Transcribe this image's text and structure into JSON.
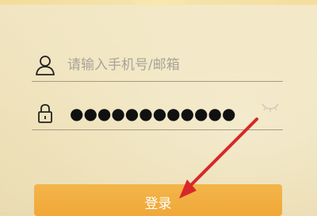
{
  "login_form": {
    "phone_field": {
      "placeholder": "请输入手机号/邮箱",
      "value": "",
      "icon": "user-icon"
    },
    "password_field": {
      "masked_value": "●●●●●●●●●●●●",
      "icon": "lock-icon",
      "toggle_icon": "eye-closed-icon"
    },
    "submit_label": "登录"
  },
  "annotation": {
    "icon": "red-arrow",
    "color": "#d8282a"
  },
  "colors": {
    "button": "#f0aa3c",
    "background": "#f1e6c3",
    "divider": "#a89a80"
  }
}
